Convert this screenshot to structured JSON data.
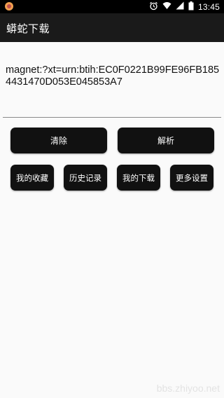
{
  "status_bar": {
    "time": "13:45",
    "icons": [
      "app-notification-icon",
      "alarm-icon",
      "wifi-icon",
      "signal-icon",
      "battery-icon"
    ]
  },
  "app_bar": {
    "title": "蟒蛇下载"
  },
  "input": {
    "value": "magnet:?xt=urn:btih:EC0F0221B99FE96FB1854431470D053E045853A7"
  },
  "buttons": {
    "clear": "清除",
    "parse": "解析",
    "favorites": "我的收藏",
    "history": "历史记录",
    "downloads": "我的下载",
    "more_settings": "更多设置"
  },
  "watermark": "bbs.zhiyoo.net",
  "colors": {
    "status_bar": "#000000",
    "app_bar": "#1a1a1a",
    "background": "#fafafa",
    "button": "#111111",
    "button_text": "#ffffff"
  }
}
